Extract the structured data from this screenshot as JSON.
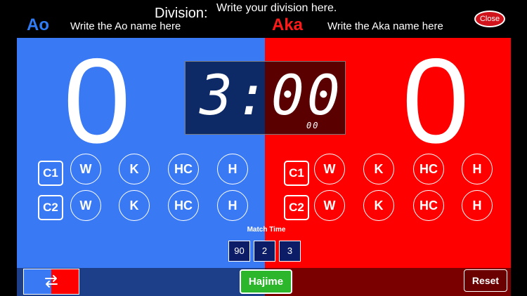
{
  "header": {
    "division_label": "Division:",
    "division_value": "Write your division here.",
    "close_label": "Close"
  },
  "ao": {
    "label": "Ao",
    "name": "Write the Ao name here",
    "score": "0",
    "color": "#3a79f4",
    "row1": {
      "c": "C1",
      "w": "W",
      "k": "K",
      "hc": "HC",
      "h": "H"
    },
    "row2": {
      "c": "C2",
      "w": "W",
      "k": "K",
      "hc": "HC",
      "h": "H"
    }
  },
  "aka": {
    "label": "Aka",
    "name": "Write the Aka name here",
    "score": "0",
    "color": "#ff0000",
    "row1": {
      "c": "C1",
      "w": "W",
      "k": "K",
      "hc": "HC",
      "h": "H"
    },
    "row2": {
      "c": "C2",
      "w": "W",
      "k": "K",
      "hc": "HC",
      "h": "H"
    }
  },
  "timer": {
    "main": "3:00",
    "sub": "00"
  },
  "match_time": {
    "label": "Match Time",
    "options": [
      "90",
      "2",
      "3"
    ]
  },
  "controls": {
    "swap_icon": "swap-arrows-icon",
    "hajime_label": "Hajime",
    "reset_label": "Reset",
    "hajime_color": "#2bb62b"
  }
}
